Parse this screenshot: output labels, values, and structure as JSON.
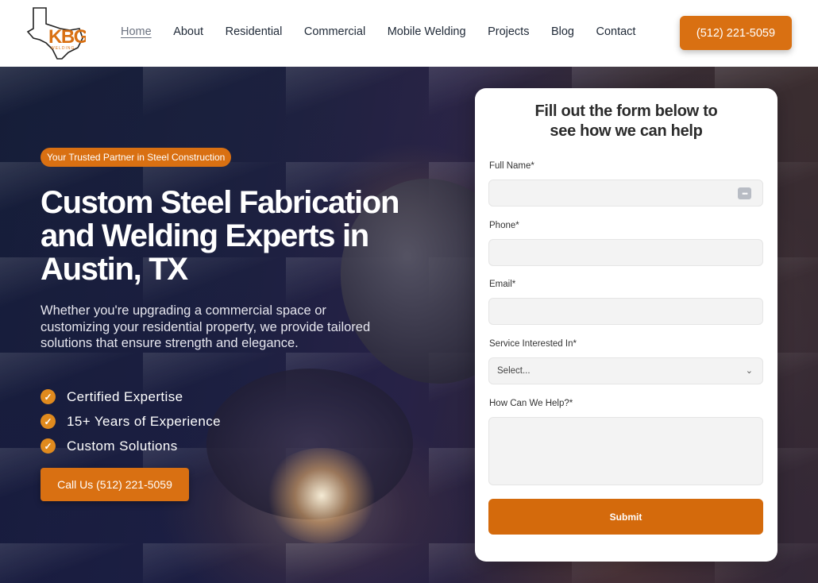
{
  "brand": {
    "logo_text": "KBG",
    "logo_subtext": "WELDING",
    "logo_alt": "KBG Welding logo"
  },
  "nav": {
    "items": [
      {
        "label": "Home",
        "active": true
      },
      {
        "label": "About"
      },
      {
        "label": "Residential"
      },
      {
        "label": "Commercial"
      },
      {
        "label": "Mobile Welding"
      },
      {
        "label": "Projects"
      },
      {
        "label": "Blog"
      },
      {
        "label": "Contact"
      }
    ],
    "phone_label": "(512) 221-5059"
  },
  "hero": {
    "badge": "Your Trusted Partner in Steel Construction",
    "title": "Custom Steel Fabrication and Welding Experts in Austin, TX",
    "description": "Whether you're upgrading a commercial space or customizing your residential property, we provide tailored solutions that ensure strength and elegance.",
    "features": [
      "Certified Expertise",
      "15+ Years of Experience",
      "Custom Solutions"
    ],
    "cta_label": "Call Us (512) 221-5059"
  },
  "form": {
    "title": "Fill out the form below to see how we can help",
    "fields": {
      "full_name": {
        "label": "Full Name*",
        "value": ""
      },
      "phone": {
        "label": "Phone*",
        "value": ""
      },
      "email": {
        "label": "Email*",
        "value": ""
      },
      "service": {
        "label": "Service Interested In*",
        "value": "Select..."
      },
      "message": {
        "label": "How Can We Help?*",
        "value": ""
      }
    },
    "submit_label": "Submit"
  },
  "colors": {
    "accent": "#d97012",
    "text_dark": "#1f2937",
    "field_bg": "#f3f3f3"
  },
  "icons": {
    "check": "check-circle-icon",
    "autofill": "autofill-icon",
    "dropdown": "chevron-down-icon"
  }
}
